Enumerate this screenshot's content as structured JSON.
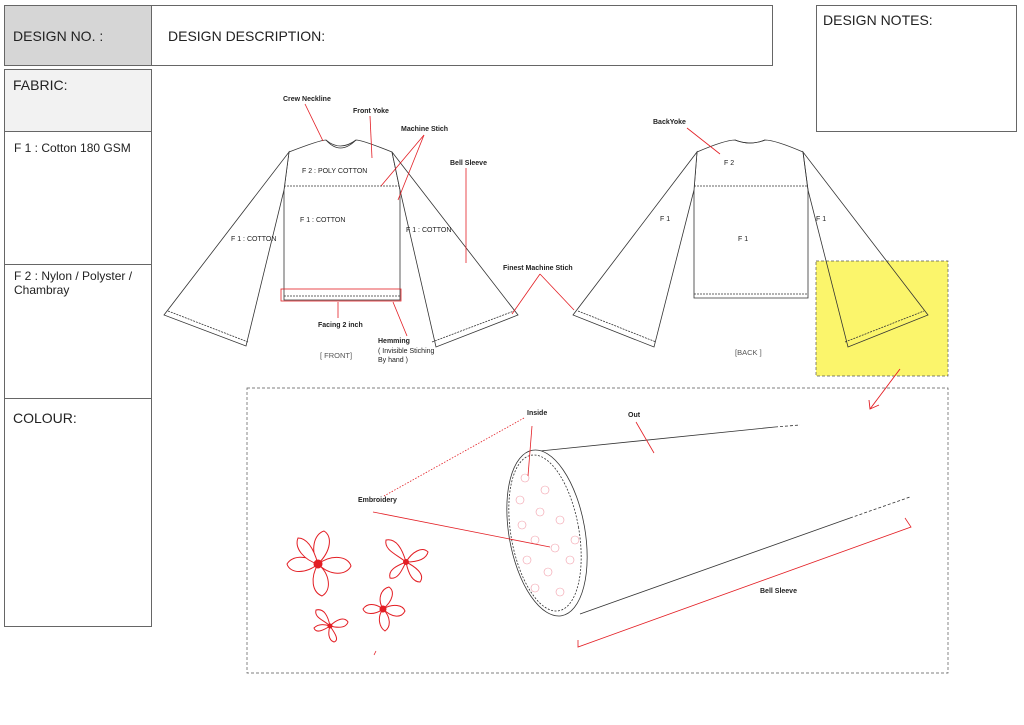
{
  "header": {
    "design_no": "DESIGN NO. :",
    "design_description": "DESIGN DESCRIPTION:",
    "design_notes": "DESIGN NOTES:"
  },
  "sidebar": {
    "fabric_title": "FABRIC:",
    "fabric_1": "F 1 : Cotton 180 GSM",
    "fabric_2": "F 2 : Nylon / Polyster / Chambray",
    "colour_title": "COLOUR:"
  },
  "front": {
    "crew_neckline": "Crew Neckline",
    "front_yoke": "Front Yoke",
    "machine_stich": "Machine Stich",
    "bell_sleeve": "Bell Sleeve",
    "yoke_fabric": "F 2 : POLY COTTON",
    "body_fabric": "F 1 : COTTON",
    "left_sleeve_fabric": "F 1 : COTTON",
    "right_sleeve_fabric": "F 1 : COTTON",
    "facing": "Facing 2 inch",
    "hemming": "Hemming",
    "hemming_note_1": "( Invisible Stiching",
    "hemming_note_2": "By hand )",
    "view": "[ FRONT]"
  },
  "finest_machine_stich": "Finest Machine Stich",
  "back": {
    "back_yoke": "BackYoke",
    "yoke_fabric": "F 2",
    "body_fabric": "F 1",
    "left_sleeve_fabric": "F 1",
    "right_sleeve_fabric": "F 1",
    "view": "[BACK ]"
  },
  "detail": {
    "inside": "Inside",
    "out": "Out",
    "embroidery": "Embroidery",
    "bell_sleeve": "Bell Sleeve"
  },
  "colors": {
    "callout": "#e31e24",
    "highlight": "#fbf56b",
    "header_fill": "#d6d6d6",
    "fabric_fill": "#f2f2f2"
  }
}
